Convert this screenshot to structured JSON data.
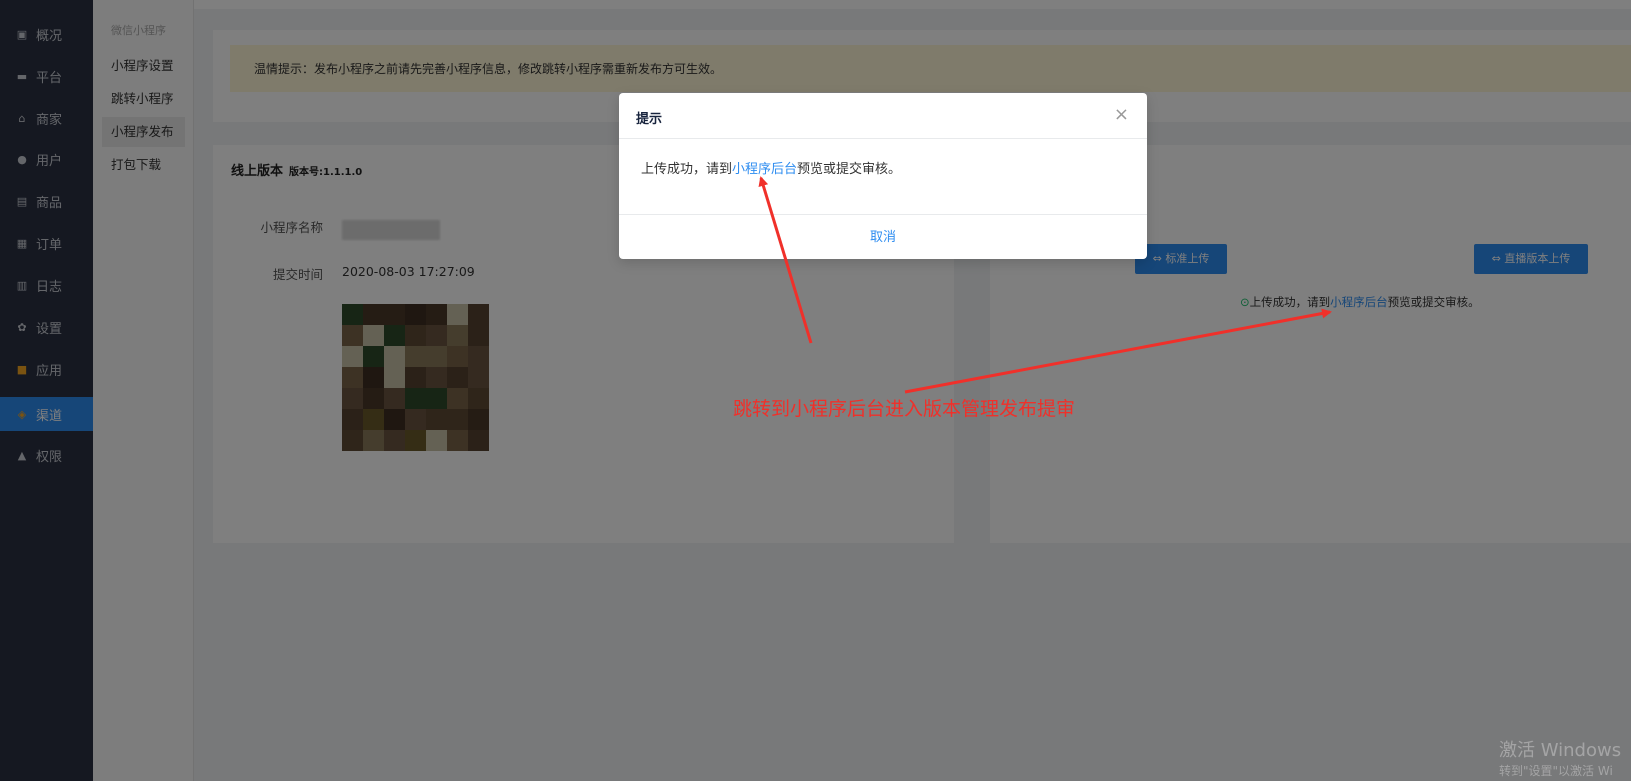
{
  "nav": {
    "items": [
      {
        "label": "概况",
        "icon": "dashboard-icon",
        "glyph": "▣"
      },
      {
        "label": "平台",
        "icon": "monitor-icon",
        "glyph": "▬"
      },
      {
        "label": "商家",
        "icon": "store-icon",
        "glyph": "⌂"
      },
      {
        "label": "用户",
        "icon": "user-icon",
        "glyph": "●"
      },
      {
        "label": "商品",
        "icon": "goods-icon",
        "glyph": "▤"
      },
      {
        "label": "订单",
        "icon": "order-icon",
        "glyph": "▦"
      },
      {
        "label": "日志",
        "icon": "log-icon",
        "glyph": "▥"
      },
      {
        "label": "设置",
        "icon": "gear-icon",
        "glyph": "✿"
      },
      {
        "label": "应用",
        "icon": "apps-icon",
        "glyph": "■"
      },
      {
        "label": "渠道",
        "icon": "channel-icon",
        "glyph": "◈",
        "active": true
      },
      {
        "label": "权限",
        "icon": "lock-icon",
        "glyph": "▲"
      }
    ]
  },
  "subnav": {
    "title": "微信小程序",
    "items": [
      "小程序设置",
      "跳转小程序",
      "小程序发布",
      "打包下载"
    ],
    "active_index": 2
  },
  "notice": {
    "text": "温情提示：发布小程序之前请先完善小程序信息，修改跳转小程序需重新发布方可生效。"
  },
  "online": {
    "title": "线上版本",
    "version_label": "版本号:1.1.1.0",
    "name_label": "小程序名称",
    "time_label": "提交时间",
    "time_value": "2020-08-03 17:27:09"
  },
  "upload": {
    "standard_button": "标准上传",
    "live_button": "直播版本上传",
    "status_prefix": "上传成功，请到",
    "status_link": "小程序后台",
    "status_suffix": "预览或提交审核。"
  },
  "modal": {
    "title": "提示",
    "body_prefix": "上传成功，请到",
    "body_link": "小程序后台",
    "body_suffix": "预览或提交审核。",
    "cancel": "取消"
  },
  "annotation": {
    "text": "跳转到小程序后台进入版本管理发布提审",
    "color": "#f0302a"
  },
  "watermark": {
    "title": "激活 Windows",
    "subtitle": "转到\"设置\"以激活 Wi"
  },
  "colors": {
    "nav_bg": "#2b3142",
    "accent": "#2d8cf0",
    "notice_bg": "#fff6d6",
    "success": "#19be6b"
  }
}
